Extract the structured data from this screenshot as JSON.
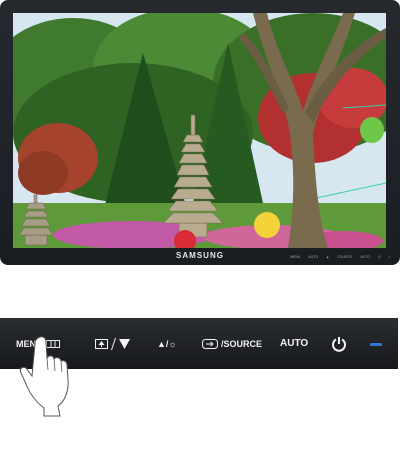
{
  "monitor": {
    "brand": "SAMSUNG",
    "mini_controls": [
      "MENU",
      "AUTO",
      "▲",
      "SOURCE",
      "AUTO",
      "⏻",
      "▪"
    ],
    "screen_scene": "pagoda-garden-photo"
  },
  "button_bar": {
    "menu_label": "MENU",
    "brightness_label": "▲/☼",
    "source_label": "/SOURCE",
    "auto_label": "AUTO",
    "power_icon": "power-icon",
    "power_led_color": "#2a7bd8"
  }
}
